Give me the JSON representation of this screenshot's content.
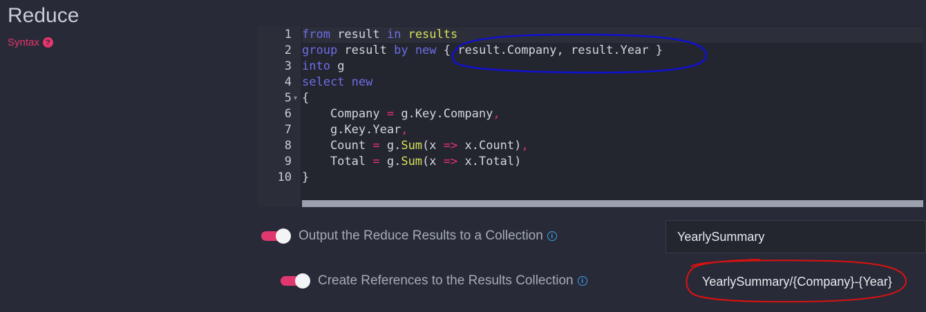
{
  "section_title": "Reduce",
  "syntax_link": "Syntax",
  "syntax_help_glyph": "?",
  "info_glyph": "i",
  "code_lines": [
    {
      "num": "1",
      "tokens": [
        {
          "t": "from",
          "c": "kw"
        },
        {
          "t": " result ",
          "c": "tx"
        },
        {
          "t": "in",
          "c": "kw"
        },
        {
          "t": " ",
          "c": "tx"
        },
        {
          "t": "results",
          "c": "fn"
        }
      ]
    },
    {
      "num": "2",
      "tokens": [
        {
          "t": "group",
          "c": "kw"
        },
        {
          "t": " result ",
          "c": "tx"
        },
        {
          "t": "by",
          "c": "kw"
        },
        {
          "t": " ",
          "c": "tx"
        },
        {
          "t": "new",
          "c": "kw"
        },
        {
          "t": " { result.Company, result.Year }",
          "c": "tx"
        }
      ]
    },
    {
      "num": "3",
      "tokens": [
        {
          "t": "into",
          "c": "kw"
        },
        {
          "t": " g",
          "c": "tx"
        }
      ]
    },
    {
      "num": "4",
      "tokens": [
        {
          "t": "select",
          "c": "kw"
        },
        {
          "t": " ",
          "c": "tx"
        },
        {
          "t": "new",
          "c": "kw"
        }
      ]
    },
    {
      "num": "5",
      "fold": true,
      "tokens": [
        {
          "t": "{",
          "c": "tx"
        }
      ]
    },
    {
      "num": "6",
      "tokens": [
        {
          "t": "    Company ",
          "c": "tx"
        },
        {
          "t": "=",
          "c": "op"
        },
        {
          "t": " g.Key.Company",
          "c": "tx"
        },
        {
          "t": ",",
          "c": "op"
        }
      ]
    },
    {
      "num": "7",
      "tokens": [
        {
          "t": "    g.Key.Year",
          "c": "tx"
        },
        {
          "t": ",",
          "c": "op"
        }
      ]
    },
    {
      "num": "8",
      "tokens": [
        {
          "t": "    Count ",
          "c": "tx"
        },
        {
          "t": "=",
          "c": "op"
        },
        {
          "t": " g.",
          "c": "tx"
        },
        {
          "t": "Sum",
          "c": "fn"
        },
        {
          "t": "(x ",
          "c": "tx"
        },
        {
          "t": "=>",
          "c": "op"
        },
        {
          "t": " x.Count)",
          "c": "tx"
        },
        {
          "t": ",",
          "c": "op"
        }
      ]
    },
    {
      "num": "9",
      "tokens": [
        {
          "t": "    Total ",
          "c": "tx"
        },
        {
          "t": "=",
          "c": "op"
        },
        {
          "t": " g.",
          "c": "tx"
        },
        {
          "t": "Sum",
          "c": "fn"
        },
        {
          "t": "(x ",
          "c": "tx"
        },
        {
          "t": "=>",
          "c": "op"
        },
        {
          "t": " x.Total)",
          "c": "tx"
        }
      ]
    },
    {
      "num": "10",
      "tokens": [
        {
          "t": "}",
          "c": "tx"
        }
      ]
    }
  ],
  "output_option": {
    "label": "Output the Reduce Results to a Collection",
    "enabled": true,
    "collection_value": "YearlySummary"
  },
  "references_option": {
    "label": "Create References to the Results Collection",
    "enabled": true,
    "pattern_value": "YearlySummary/{Company}-{Year}"
  },
  "colors": {
    "accent": "#e8336d",
    "keyword": "#6f6ee7",
    "function": "#d7e05a",
    "annotation_blue": "#1010d0",
    "annotation_red": "#e01010"
  }
}
